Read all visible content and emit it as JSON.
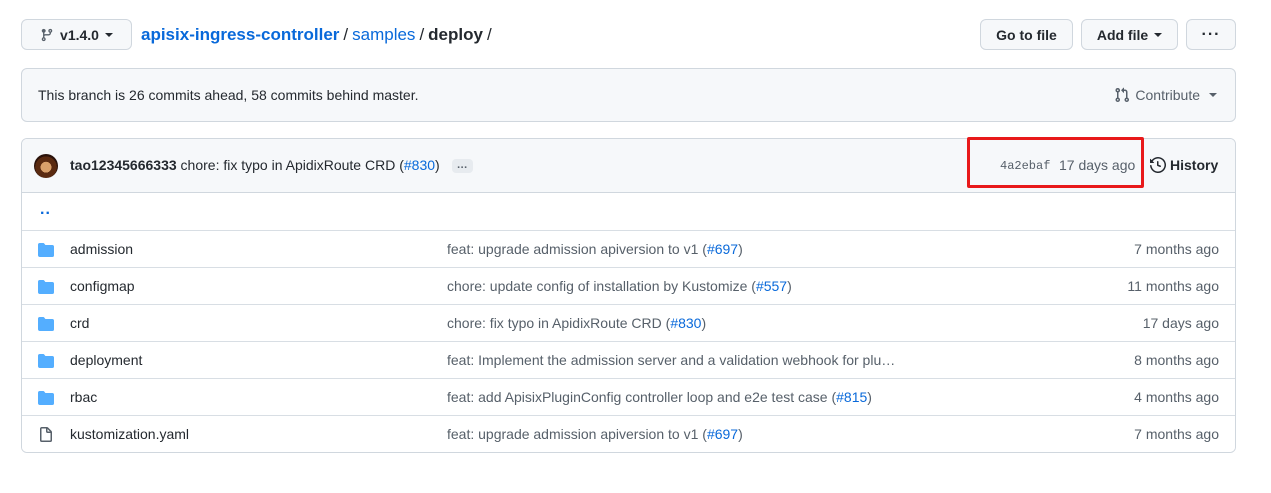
{
  "header": {
    "branch_label": "v1.4.0",
    "repo": "apisix-ingress-controller",
    "path": [
      {
        "label": "samples"
      },
      {
        "label": "deploy"
      }
    ],
    "separator": "/",
    "goto_file_label": "Go to file",
    "add_file_label": "Add file",
    "more_label": "···"
  },
  "branch_status": {
    "message": "This branch is 26 commits ahead, 58 commits behind master.",
    "contribute_label": "Contribute"
  },
  "latest_commit": {
    "author": "tao12345666333",
    "message_prefix": "chore: fix typo in ApidixRoute CRD (",
    "pr": "#830",
    "message_suffix": ")",
    "ellipsis": "…",
    "sha": "4a2ebaf",
    "age": "17 days ago",
    "history_label": "History"
  },
  "updir": "..",
  "files": [
    {
      "name": "admission",
      "type": "folder",
      "msg_prefix": "feat: upgrade admission apiversion to v1 (",
      "pr": "#697",
      "msg_suffix": ")",
      "age": "7 months ago"
    },
    {
      "name": "configmap",
      "type": "folder",
      "msg_prefix": "chore: update config of installation by Kustomize (",
      "pr": "#557",
      "msg_suffix": ")",
      "age": "11 months ago"
    },
    {
      "name": "crd",
      "type": "folder",
      "msg_prefix": "chore: fix typo in ApidixRoute CRD (",
      "pr": "#830",
      "msg_suffix": ")",
      "age": "17 days ago"
    },
    {
      "name": "deployment",
      "type": "folder",
      "msg_prefix": "feat: Implement the admission server and a validation webhook for plu…",
      "pr": "",
      "msg_suffix": "",
      "age": "8 months ago"
    },
    {
      "name": "rbac",
      "type": "folder",
      "msg_prefix": "feat: add ApisixPluginConfig controller loop and e2e test case (",
      "pr": "#815",
      "msg_suffix": ")",
      "age": "4 months ago"
    },
    {
      "name": "kustomization.yaml",
      "type": "file",
      "msg_prefix": "feat: upgrade admission apiversion to v1 (",
      "pr": "#697",
      "msg_suffix": ")",
      "age": "7 months ago"
    }
  ],
  "colors": {
    "link": "#0969da",
    "folder": "#54aeff",
    "highlight": "#e8191a"
  }
}
